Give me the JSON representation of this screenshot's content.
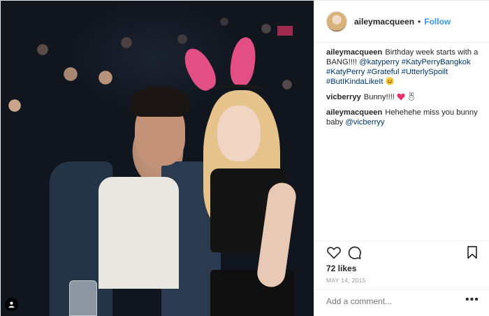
{
  "post": {
    "author": {
      "username": "aileymacqueen",
      "separator": "•",
      "follow_label": "Follow"
    },
    "caption": {
      "username": "aileymacqueen",
      "text": "Birthday week starts with a BANG!!!!",
      "tags": [
        "@katyperry",
        "#KatyPerryBangkok",
        "#KatyPerry",
        "#Grateful",
        "#UtterlySpoilt",
        "#ButIKindaLikeIt"
      ],
      "emoji": "smile-emoji"
    },
    "comments": [
      {
        "username": "vicberryy",
        "text": "Bunny!!!!",
        "emoji": "heart-emoji rabbit-emoji"
      },
      {
        "username": "aileymacqueen",
        "text": "Hehehehe miss you bunny baby",
        "mention": "@vicberryy"
      }
    ],
    "likes": "72 likes",
    "date": "MAY 14, 2015",
    "add_comment_placeholder": "Add a comment...",
    "more_label": "•••",
    "icons": [
      "heart-icon",
      "comment-icon",
      "bookmark-icon",
      "user-tag-icon"
    ]
  },
  "colors": {
    "link": "#003569",
    "follow": "#3897f0",
    "muted": "#999999",
    "border": "#efefef"
  }
}
